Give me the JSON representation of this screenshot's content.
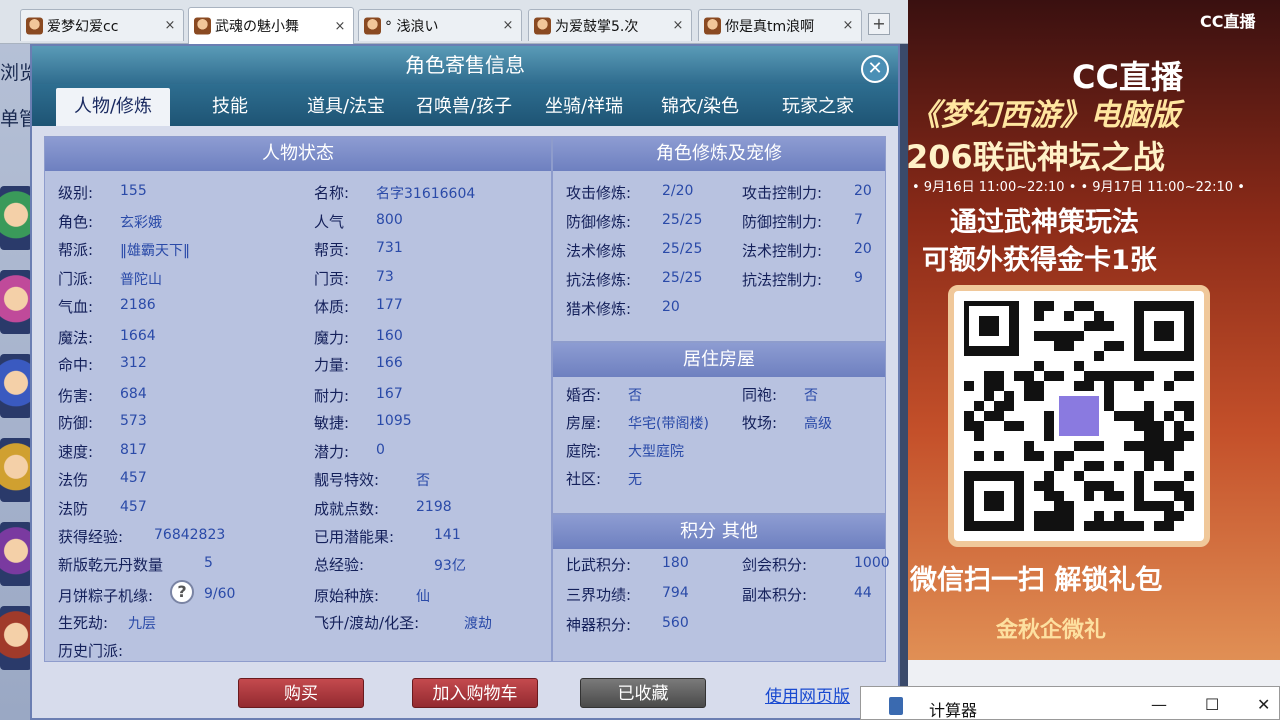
{
  "browser": {
    "tabs": [
      {
        "label": "爱梦幻爱cc",
        "active": false
      },
      {
        "label": "武魂の魅小舞",
        "active": true
      },
      {
        "label": "° 浅浪い",
        "active": false
      },
      {
        "label": "为爱鼓掌5.次",
        "active": false
      },
      {
        "label": "你是真tm浪啊",
        "active": false
      }
    ],
    "tab_close": "×",
    "new_tab": "+"
  },
  "left_strip": {
    "text1": "浏览",
    "text2": "单管"
  },
  "dialog": {
    "title": "角色寄售信息",
    "close": "✕",
    "tabs": [
      "人物/修炼",
      "技能",
      "道具/法宝",
      "召唤兽/孩子",
      "坐骑/祥瑞",
      "锦衣/染色",
      "玩家之家"
    ],
    "status": {
      "heading": "人物状态",
      "left": [
        {
          "label": "级别:",
          "value": "155"
        },
        {
          "label": "角色:",
          "value": "玄彩娥"
        },
        {
          "label": "帮派:",
          "value": "‖雄霸天下‖"
        },
        {
          "label": "门派:",
          "value": "普陀山"
        },
        {
          "label": "气血:",
          "value": "2186"
        },
        {
          "label": "魔法:",
          "value": "1664"
        },
        {
          "label": "命中:",
          "value": "312"
        },
        {
          "label": "伤害:",
          "value": "684"
        },
        {
          "label": "防御:",
          "value": "573"
        },
        {
          "label": "速度:",
          "value": "817"
        },
        {
          "label": "法伤",
          "value": "457"
        },
        {
          "label": "法防",
          "value": "457"
        },
        {
          "label": "获得经验:",
          "value": "76842823"
        },
        {
          "label": "新版乾元丹数量",
          "value": "5"
        },
        {
          "label": "月饼粽子机缘:",
          "value": "9/60"
        },
        {
          "label": "生死劫:",
          "value": "九层"
        },
        {
          "label": "历史门派:",
          "value": ""
        }
      ],
      "help": "?",
      "right": [
        {
          "label": "名称:",
          "value": "名字31616604"
        },
        {
          "label": "人气",
          "value": "800"
        },
        {
          "label": "帮贡:",
          "value": "731"
        },
        {
          "label": "门贡:",
          "value": "73"
        },
        {
          "label": "体质:",
          "value": "177"
        },
        {
          "label": "魔力:",
          "value": "160"
        },
        {
          "label": "力量:",
          "value": "166"
        },
        {
          "label": "耐力:",
          "value": "167"
        },
        {
          "label": "敏捷:",
          "value": "1095"
        },
        {
          "label": "潜力:",
          "value": "0"
        },
        {
          "label": "靓号特效:",
          "value": "否"
        },
        {
          "label": "成就点数:",
          "value": "2198"
        },
        {
          "label": "已用潜能果:",
          "value": "141"
        },
        {
          "label": "总经验:",
          "value": "93亿"
        },
        {
          "label": "原始种族:",
          "value": "仙"
        },
        {
          "label": "飞升/渡劫/化圣:",
          "value": "渡劫"
        }
      ]
    },
    "cultivation": {
      "heading": "角色修炼及宠修",
      "rows": [
        {
          "label": "攻击修炼:",
          "value": "2/20",
          "label2": "攻击控制力:",
          "value2": "20"
        },
        {
          "label": "防御修炼:",
          "value": "25/25",
          "label2": "防御控制力:",
          "value2": "7"
        },
        {
          "label": "法术修炼",
          "value": "25/25",
          "label2": "法术控制力:",
          "value2": "20"
        },
        {
          "label": "抗法修炼:",
          "value": "25/25",
          "label2": "抗法控制力:",
          "value2": "9"
        },
        {
          "label": "猎术修炼:",
          "value": "20",
          "label2": "",
          "value2": ""
        }
      ]
    },
    "housing": {
      "heading": "居住房屋",
      "rows": [
        {
          "label": "婚否:",
          "value": "否",
          "label2": "同袍:",
          "value2": "否"
        },
        {
          "label": "房屋:",
          "value": "华宅(带阁楼)",
          "label2": "牧场:",
          "value2": "高级"
        },
        {
          "label": "庭院:",
          "value": "大型庭院",
          "label2": "",
          "value2": ""
        },
        {
          "label": "社区:",
          "value": "无",
          "label2": "",
          "value2": ""
        }
      ]
    },
    "points": {
      "heading": "积分 其他",
      "rows": [
        {
          "label": "比武积分:",
          "value": "180",
          "label2": "剑会积分:",
          "value2": "1000"
        },
        {
          "label": "三界功绩:",
          "value": "794",
          "label2": "副本积分:",
          "value2": "44"
        },
        {
          "label": "神器积分:",
          "value": "560",
          "label2": "",
          "value2": ""
        }
      ]
    },
    "buttons": {
      "buy": "购买",
      "cart": "加入购物车",
      "collected": "已收藏",
      "web": "使用网页版"
    }
  },
  "ad": {
    "logo_small": "CC直播",
    "logo_big": "CC直播",
    "title1": "《梦幻西游》电脑版",
    "title2": "206联武神坛之战",
    "dates": "• 9月16日 11:00~22:10 •  • 9月17日 11:00~22:10 •",
    "line1": "通过武神策玩法",
    "line2": "可额外获得金卡1张",
    "scan": "微信扫一扫 解锁礼包",
    "gift": "金秋企微礼"
  },
  "calculator": {
    "title": "计算器",
    "minimize": "—",
    "maximize": "☐",
    "close": "✕"
  }
}
